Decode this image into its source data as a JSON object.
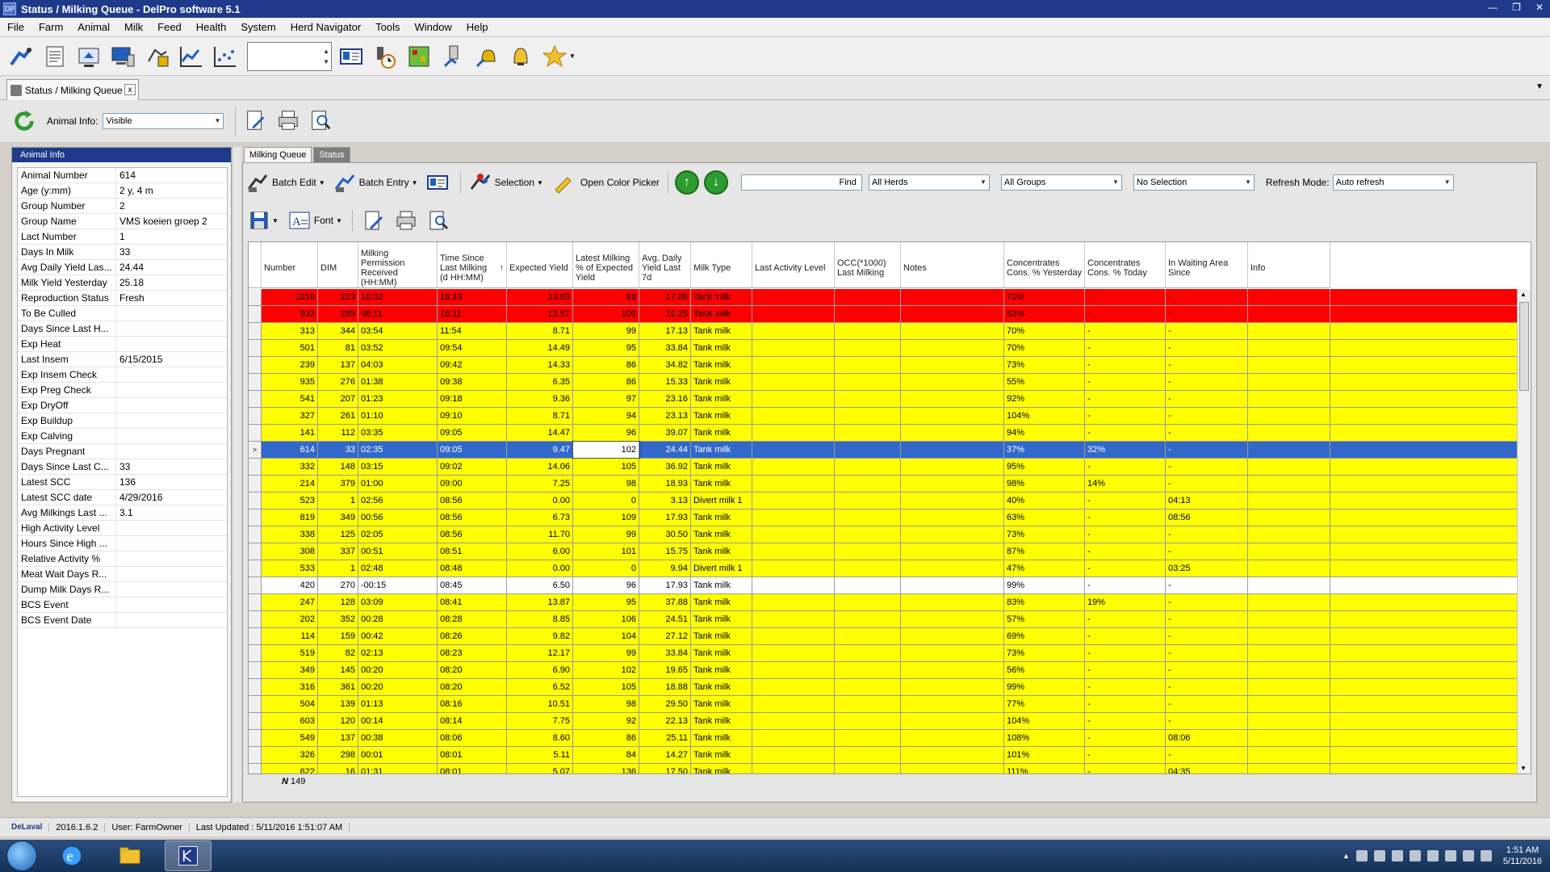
{
  "window": {
    "title": "Status / Milking Queue - DelPro software 5.1",
    "app_icon_text": "DP"
  },
  "menu": [
    "File",
    "Farm",
    "Animal",
    "Milk",
    "Feed",
    "Health",
    "System",
    "Herd Navigator",
    "Tools",
    "Window",
    "Help"
  ],
  "document_tab": {
    "label": "Status / Milking Queue",
    "close": "x"
  },
  "animal_info": {
    "label": "Animal Info:",
    "value": "Visible"
  },
  "left_panel": {
    "header": "Animal Info",
    "rows": [
      {
        "k": "Animal Number",
        "v": "614"
      },
      {
        "k": "Age (y:mm)",
        "v": "2 y, 4 m"
      },
      {
        "k": "Group Number",
        "v": "2"
      },
      {
        "k": "Group Name",
        "v": "VMS koeien groep 2"
      },
      {
        "k": "Lact Number",
        "v": "1"
      },
      {
        "k": "Days In Milk",
        "v": "33"
      },
      {
        "k": "Avg Daily Yield Las...",
        "v": "24.44"
      },
      {
        "k": "Milk Yield Yesterday",
        "v": "25.18"
      },
      {
        "k": "Reproduction Status",
        "v": "Fresh"
      },
      {
        "k": "To Be Culled",
        "v": ""
      },
      {
        "k": "Days Since Last H...",
        "v": ""
      },
      {
        "k": "Exp Heat",
        "v": ""
      },
      {
        "k": "Last Insem",
        "v": "6/15/2015"
      },
      {
        "k": "Exp Insem Check",
        "v": ""
      },
      {
        "k": "Exp Preg Check",
        "v": ""
      },
      {
        "k": "Exp DryOff",
        "v": ""
      },
      {
        "k": "Exp Buildup",
        "v": ""
      },
      {
        "k": "Exp Calving",
        "v": ""
      },
      {
        "k": "Days Pregnant",
        "v": ""
      },
      {
        "k": "Days Since Last C...",
        "v": "33"
      },
      {
        "k": "Latest SCC",
        "v": "136"
      },
      {
        "k": "Latest SCC date",
        "v": "4/29/2016"
      },
      {
        "k": "Avg Milkings Last ...",
        "v": "3.1"
      },
      {
        "k": "High Activity Level",
        "v": ""
      },
      {
        "k": "Hours Since High ...",
        "v": ""
      },
      {
        "k": "Relative Activity %",
        "v": ""
      },
      {
        "k": "Meat Wait Days R...",
        "v": ""
      },
      {
        "k": "Dump Milk Days R...",
        "v": ""
      },
      {
        "k": "BCS Event",
        "v": ""
      },
      {
        "k": "BCS Event Date",
        "v": ""
      }
    ]
  },
  "subtabs": [
    "Milking Queue",
    "Status"
  ],
  "grid_toolbar": {
    "batch_edit": "Batch Edit",
    "batch_entry": "Batch Entry",
    "selection": "Selection",
    "open_color_picker": "Open Color Picker",
    "find": "Find",
    "herds": "All Herds",
    "groups": "All Groups",
    "selection_filter": "No Selection",
    "refresh_label": "Refresh Mode:",
    "refresh_value": "Auto refresh",
    "font": "Font"
  },
  "columns": [
    "Number",
    "DIM",
    "Milking Permission Received (HH:MM)",
    "Time Since Last Milking (d HH:MM)",
    "Expected Yield",
    "Latest Milking % of Expected Yield",
    "Avg. Daily Yield Last 7d",
    "Milk Type",
    "Last Activity Level",
    "OCC(*1000) Last Milking",
    "Notes",
    "Concentrates Cons. % Yesterday",
    "Concentrates Cons. % Today",
    "In Waiting Area Since",
    "Info"
  ],
  "sort_indicator": "↑",
  "rows": [
    {
      "c": "red",
      "d": [
        "1016",
        "223",
        "10:32",
        "18:16",
        "13.89",
        "68",
        "17.96",
        "Tank milk",
        "",
        "",
        "",
        "70%",
        "-",
        "-",
        ""
      ]
    },
    {
      "c": "red",
      "d": [
        "932",
        "285",
        "08:11",
        "16:11",
        "13.57",
        "100",
        "19.25",
        "Tank milk",
        "",
        "",
        "",
        "62%",
        "-",
        "-",
        ""
      ]
    },
    {
      "c": "yellow",
      "d": [
        "313",
        "344",
        "03:54",
        "11:54",
        "8.71",
        "99",
        "17.13",
        "Tank milk",
        "",
        "",
        "",
        "70%",
        "-",
        "-",
        ""
      ]
    },
    {
      "c": "yellow",
      "d": [
        "501",
        "81",
        "03:52",
        "09:54",
        "14.49",
        "95",
        "33.84",
        "Tank milk",
        "",
        "",
        "",
        "70%",
        "-",
        "-",
        ""
      ]
    },
    {
      "c": "yellow",
      "d": [
        "239",
        "137",
        "04:03",
        "09:42",
        "14.33",
        "86",
        "34.82",
        "Tank milk",
        "",
        "",
        "",
        "73%",
        "-",
        "-",
        ""
      ]
    },
    {
      "c": "yellow",
      "d": [
        "935",
        "276",
        "01:38",
        "09:38",
        "6.35",
        "86",
        "15.33",
        "Tank milk",
        "",
        "",
        "",
        "55%",
        "-",
        "-",
        ""
      ]
    },
    {
      "c": "yellow",
      "d": [
        "541",
        "207",
        "01:23",
        "09:18",
        "9.36",
        "97",
        "23.16",
        "Tank milk",
        "",
        "",
        "",
        "92%",
        "-",
        "-",
        ""
      ]
    },
    {
      "c": "yellow",
      "d": [
        "327",
        "261",
        "01:10",
        "09:10",
        "8.71",
        "94",
        "23.13",
        "Tank milk",
        "",
        "",
        "",
        "104%",
        "-",
        "-",
        ""
      ]
    },
    {
      "c": "yellow",
      "d": [
        "141",
        "112",
        "03:35",
        "09:05",
        "14.47",
        "96",
        "39.07",
        "Tank milk",
        "",
        "",
        "",
        "94%",
        "-",
        "-",
        ""
      ]
    },
    {
      "c": "selected",
      "d": [
        "614",
        "33",
        "02:35",
        "09:05",
        "9.47",
        "102",
        "24.44",
        "Tank milk",
        "",
        "",
        "",
        "37%",
        "32%",
        "-",
        ""
      ]
    },
    {
      "c": "yellow",
      "d": [
        "332",
        "148",
        "03:15",
        "09:02",
        "14.06",
        "105",
        "36.92",
        "Tank milk",
        "",
        "",
        "",
        "95%",
        "-",
        "-",
        ""
      ]
    },
    {
      "c": "yellow",
      "d": [
        "214",
        "379",
        "01:00",
        "09:00",
        "7.25",
        "98",
        "18.93",
        "Tank milk",
        "",
        "",
        "",
        "98%",
        "14%",
        "-",
        ""
      ]
    },
    {
      "c": "yellow",
      "d": [
        "523",
        "1",
        "02:56",
        "08:56",
        "0.00",
        "0",
        "3.13",
        "Divert milk 1",
        "",
        "",
        "",
        "40%",
        "-",
        "04:13",
        ""
      ]
    },
    {
      "c": "yellow",
      "d": [
        "819",
        "349",
        "00:56",
        "08:56",
        "6.73",
        "109",
        "17.93",
        "Tank milk",
        "",
        "",
        "",
        "63%",
        "-",
        "08:56",
        ""
      ]
    },
    {
      "c": "yellow",
      "d": [
        "338",
        "125",
        "02:05",
        "08:56",
        "11.70",
        "99",
        "30.50",
        "Tank milk",
        "",
        "",
        "",
        "73%",
        "-",
        "-",
        ""
      ]
    },
    {
      "c": "yellow",
      "d": [
        "308",
        "337",
        "00:51",
        "08:51",
        "6.00",
        "101",
        "15.75",
        "Tank milk",
        "",
        "",
        "",
        "87%",
        "-",
        "-",
        ""
      ]
    },
    {
      "c": "yellow",
      "d": [
        "533",
        "1",
        "02:48",
        "08:48",
        "0.00",
        "0",
        "9.94",
        "Divert milk 1",
        "",
        "",
        "",
        "47%",
        "-",
        "03:25",
        ""
      ]
    },
    {
      "c": "white",
      "d": [
        "420",
        "270",
        "-00:15",
        "08:45",
        "6.50",
        "96",
        "17.93",
        "Tank milk",
        "",
        "",
        "",
        "99%",
        "-",
        "-",
        ""
      ]
    },
    {
      "c": "yellow",
      "d": [
        "247",
        "128",
        "03:09",
        "08:41",
        "13.87",
        "95",
        "37.88",
        "Tank milk",
        "",
        "",
        "",
        "83%",
        "19%",
        "-",
        ""
      ]
    },
    {
      "c": "yellow",
      "d": [
        "202",
        "352",
        "00:28",
        "08:28",
        "8.85",
        "106",
        "24.51",
        "Tank milk",
        "",
        "",
        "",
        "57%",
        "-",
        "-",
        ""
      ]
    },
    {
      "c": "yellow",
      "d": [
        "114",
        "159",
        "00:42",
        "08:26",
        "9.82",
        "104",
        "27.12",
        "Tank milk",
        "",
        "",
        "",
        "69%",
        "-",
        "-",
        ""
      ]
    },
    {
      "c": "yellow",
      "d": [
        "519",
        "82",
        "02:13",
        "08:23",
        "12.17",
        "99",
        "33.84",
        "Tank milk",
        "",
        "",
        "",
        "73%",
        "-",
        "-",
        ""
      ]
    },
    {
      "c": "yellow",
      "d": [
        "349",
        "145",
        "00:20",
        "08:20",
        "6.90",
        "102",
        "19.65",
        "Tank milk",
        "",
        "",
        "",
        "56%",
        "-",
        "-",
        ""
      ]
    },
    {
      "c": "yellow",
      "d": [
        "316",
        "361",
        "00:20",
        "08:20",
        "6.52",
        "105",
        "18.88",
        "Tank milk",
        "",
        "",
        "",
        "99%",
        "-",
        "-",
        ""
      ]
    },
    {
      "c": "yellow",
      "d": [
        "504",
        "139",
        "01:13",
        "08:16",
        "10.51",
        "98",
        "29.50",
        "Tank milk",
        "",
        "",
        "",
        "77%",
        "-",
        "-",
        ""
      ]
    },
    {
      "c": "yellow",
      "d": [
        "603",
        "120",
        "00:14",
        "08:14",
        "7.75",
        "92",
        "22.13",
        "Tank milk",
        "",
        "",
        "",
        "104%",
        "-",
        "-",
        ""
      ]
    },
    {
      "c": "yellow",
      "d": [
        "549",
        "137",
        "00:38",
        "08:06",
        "8.60",
        "86",
        "25.11",
        "Tank milk",
        "",
        "",
        "",
        "108%",
        "-",
        "08:06",
        ""
      ]
    },
    {
      "c": "yellow",
      "d": [
        "326",
        "298",
        "00:01",
        "08:01",
        "5.11",
        "84",
        "14.27",
        "Tank milk",
        "",
        "",
        "",
        "101%",
        "-",
        "-",
        ""
      ]
    },
    {
      "c": "yellow",
      "d": [
        "622",
        "16",
        "01:31",
        "08:01",
        "5.07",
        "136",
        "17.50",
        "Tank milk",
        "",
        "",
        "",
        "111%",
        "-",
        "04:35",
        ""
      ]
    }
  ],
  "selected_indicator": ">",
  "footer": {
    "n_label": "N",
    "count": "149"
  },
  "statusbar": {
    "logo": "DeLaval",
    "version": "2016.1.6.2",
    "user": "User: FarmOwner",
    "updated": "Last Updated : 5/11/2016 1:51:07 AM"
  },
  "taskbar": {
    "time": "1:51 AM",
    "date": "5/11/2016"
  },
  "colors": {
    "red": "#ff0000",
    "yellow": "#ffff00",
    "selected": "#3168c9",
    "title": "#1f3a8a"
  }
}
